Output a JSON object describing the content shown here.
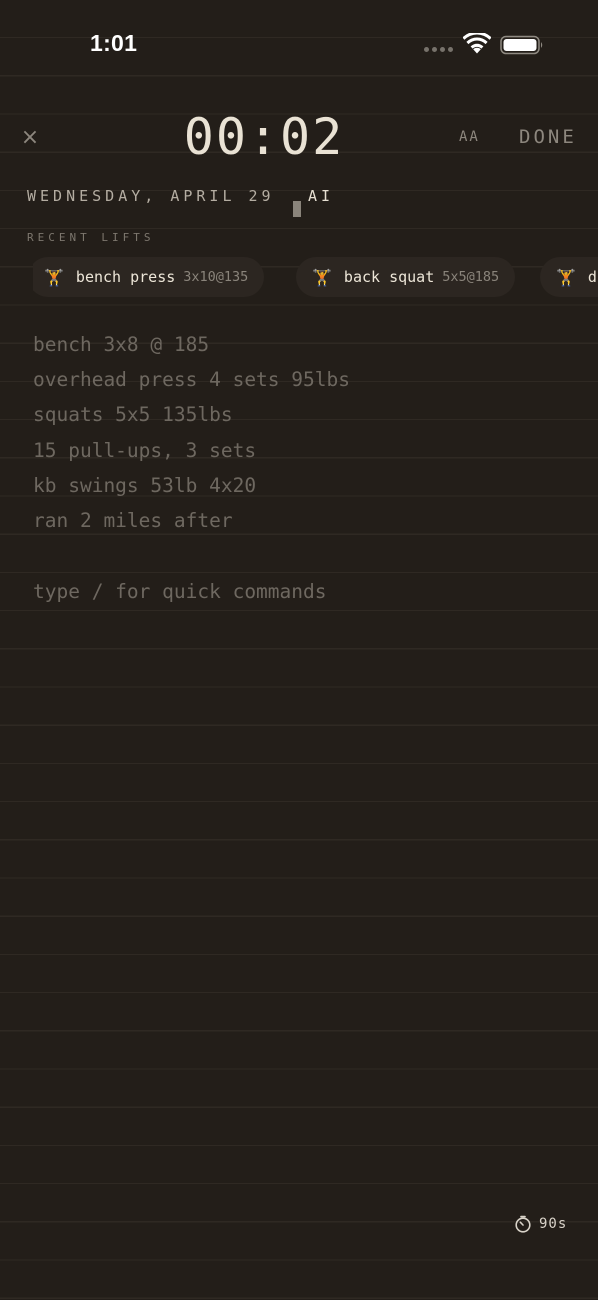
{
  "status_bar": {
    "time": "1:01"
  },
  "header": {
    "close_label": "×",
    "timer": "00:02",
    "font_size_label": "AA",
    "done_label": "DONE"
  },
  "date_row": {
    "date": "WEDNESDAY, APRIL 29",
    "ai_label": "AI"
  },
  "recent_lifts": {
    "label": "RECENT LIFTS",
    "chip_icon": "dumbbell-icon",
    "chips": [
      {
        "name": "bench press",
        "detail": "3x10@135"
      },
      {
        "name": "back squat",
        "detail": "5x5@185"
      },
      {
        "name": "d",
        "detail": ""
      }
    ]
  },
  "note": {
    "lines": [
      "bench 3x8 @ 185",
      "overhead press 4 sets 95lbs",
      "squats 5x5 135lbs",
      "15 pull-ups, 3 sets",
      "kb swings 53lb 4x20",
      "ran 2 miles after"
    ],
    "hint": "type / for quick commands"
  },
  "rest_timer": {
    "icon": "stopwatch-icon",
    "label": "90s"
  },
  "colors": {
    "background": "#231e19",
    "rule_line": "#2f2923",
    "chip_background": "#2c2621",
    "accent_icon": "#d8a63a"
  }
}
